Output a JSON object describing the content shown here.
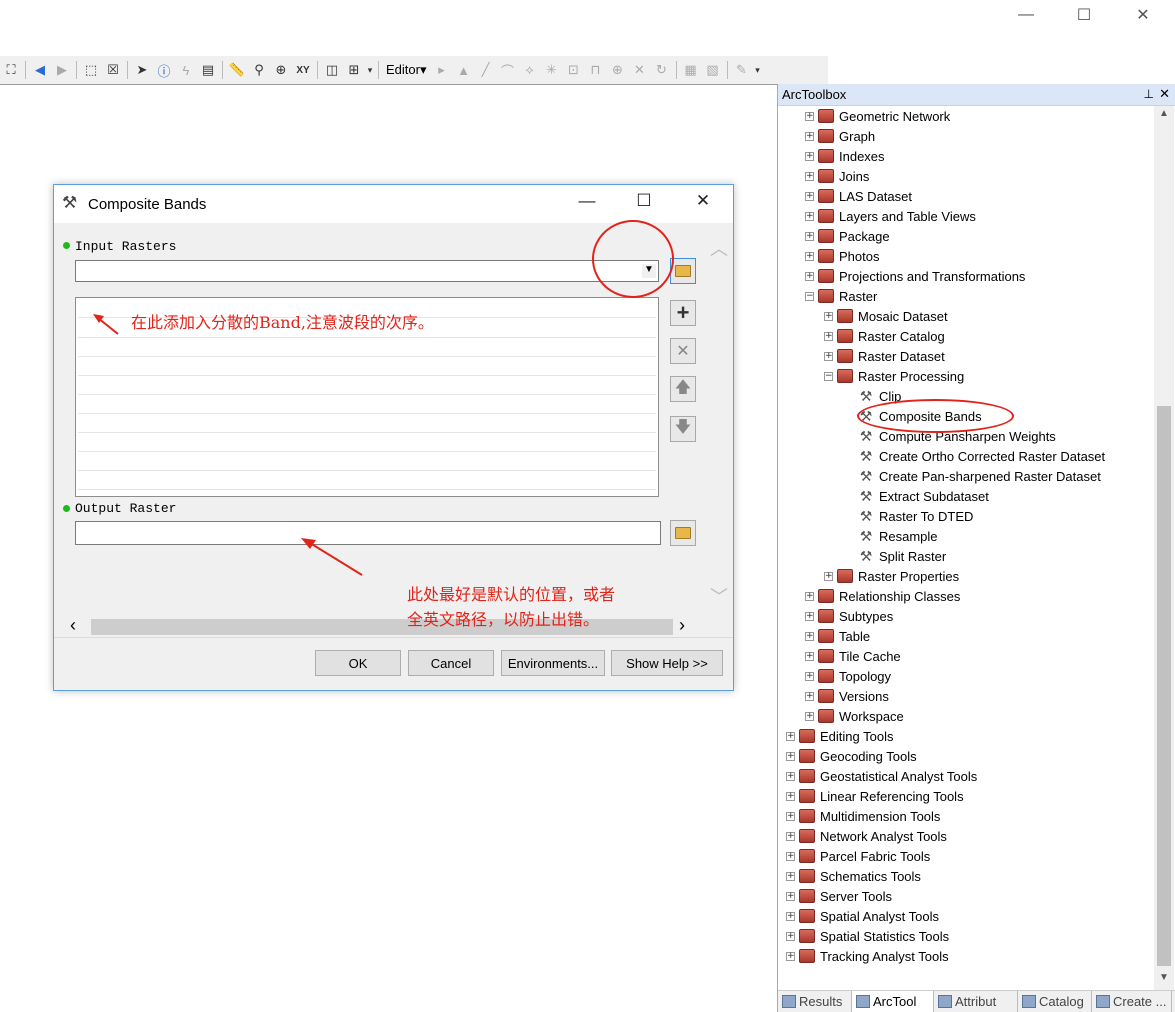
{
  "window": {
    "minimize_glyph": "—",
    "maximize_glyph": "☐",
    "close_glyph": "✕"
  },
  "toolbar": {
    "editor_label": "Editor▾"
  },
  "arctoolbox": {
    "title": "ArcToolbox",
    "pin_glyph": "ᵖ",
    "close_glyph": "✕",
    "items": [
      {
        "label": "Geometric Network",
        "level": 1,
        "expander": "+",
        "icon": "toolbox-icon"
      },
      {
        "label": "Graph",
        "level": 1,
        "expander": "+",
        "icon": "toolbox-icon"
      },
      {
        "label": "Indexes",
        "level": 1,
        "expander": "+",
        "icon": "toolbox-icon"
      },
      {
        "label": "Joins",
        "level": 1,
        "expander": "+",
        "icon": "toolbox-icon"
      },
      {
        "label": "LAS Dataset",
        "level": 1,
        "expander": "+",
        "icon": "toolbox-icon"
      },
      {
        "label": "Layers and Table Views",
        "level": 1,
        "expander": "+",
        "icon": "toolbox-icon"
      },
      {
        "label": "Package",
        "level": 1,
        "expander": "+",
        "icon": "toolbox-icon"
      },
      {
        "label": "Photos",
        "level": 1,
        "expander": "+",
        "icon": "toolbox-icon"
      },
      {
        "label": "Projections and Transformations",
        "level": 1,
        "expander": "+",
        "icon": "toolbox-icon"
      },
      {
        "label": "Raster",
        "level": 1,
        "expander": "−",
        "icon": "toolbox-icon"
      },
      {
        "label": "Mosaic Dataset",
        "level": 2,
        "expander": "+",
        "icon": "toolbox-icon"
      },
      {
        "label": "Raster Catalog",
        "level": 2,
        "expander": "+",
        "icon": "toolbox-icon"
      },
      {
        "label": "Raster Dataset",
        "level": 2,
        "expander": "+",
        "icon": "toolbox-icon"
      },
      {
        "label": "Raster Processing",
        "level": 2,
        "expander": "−",
        "icon": "toolbox-icon"
      },
      {
        "label": "Clip",
        "level": 3,
        "expander": "",
        "icon": "hammer-icon"
      },
      {
        "label": "Composite Bands",
        "level": 3,
        "expander": "",
        "icon": "hammer-icon"
      },
      {
        "label": "Compute Pansharpen Weights",
        "level": 3,
        "expander": "",
        "icon": "hammer-icon"
      },
      {
        "label": "Create Ortho Corrected Raster Dataset",
        "level": 3,
        "expander": "",
        "icon": "hammer-icon"
      },
      {
        "label": "Create Pan-sharpened Raster Dataset",
        "level": 3,
        "expander": "",
        "icon": "hammer-icon"
      },
      {
        "label": "Extract Subdataset",
        "level": 3,
        "expander": "",
        "icon": "hammer-icon"
      },
      {
        "label": "Raster To DTED",
        "level": 3,
        "expander": "",
        "icon": "hammer-icon"
      },
      {
        "label": "Resample",
        "level": 3,
        "expander": "",
        "icon": "hammer-icon"
      },
      {
        "label": "Split Raster",
        "level": 3,
        "expander": "",
        "icon": "hammer-icon"
      },
      {
        "label": "Raster Properties",
        "level": 2,
        "expander": "+",
        "icon": "toolbox-icon"
      },
      {
        "label": "Relationship Classes",
        "level": 1,
        "expander": "+",
        "icon": "toolbox-icon"
      },
      {
        "label": "Subtypes",
        "level": 1,
        "expander": "+",
        "icon": "toolbox-icon"
      },
      {
        "label": "Table",
        "level": 1,
        "expander": "+",
        "icon": "toolbox-icon"
      },
      {
        "label": "Tile Cache",
        "level": 1,
        "expander": "+",
        "icon": "toolbox-icon"
      },
      {
        "label": "Topology",
        "level": 1,
        "expander": "+",
        "icon": "toolbox-icon"
      },
      {
        "label": "Versions",
        "level": 1,
        "expander": "+",
        "icon": "toolbox-icon"
      },
      {
        "label": "Workspace",
        "level": 1,
        "expander": "+",
        "icon": "toolbox-icon"
      },
      {
        "label": "Editing Tools",
        "level": 0,
        "expander": "+",
        "icon": "toolbox-icon"
      },
      {
        "label": "Geocoding Tools",
        "level": 0,
        "expander": "+",
        "icon": "toolbox-icon"
      },
      {
        "label": "Geostatistical Analyst Tools",
        "level": 0,
        "expander": "+",
        "icon": "toolbox-icon"
      },
      {
        "label": "Linear Referencing Tools",
        "level": 0,
        "expander": "+",
        "icon": "toolbox-icon"
      },
      {
        "label": "Multidimension Tools",
        "level": 0,
        "expander": "+",
        "icon": "toolbox-icon"
      },
      {
        "label": "Network Analyst Tools",
        "level": 0,
        "expander": "+",
        "icon": "toolbox-icon"
      },
      {
        "label": "Parcel Fabric Tools",
        "level": 0,
        "expander": "+",
        "icon": "toolbox-icon"
      },
      {
        "label": "Schematics Tools",
        "level": 0,
        "expander": "+",
        "icon": "toolbox-icon"
      },
      {
        "label": "Server Tools",
        "level": 0,
        "expander": "+",
        "icon": "toolbox-icon"
      },
      {
        "label": "Spatial Analyst Tools",
        "level": 0,
        "expander": "+",
        "icon": "toolbox-icon"
      },
      {
        "label": "Spatial Statistics Tools",
        "level": 0,
        "expander": "+",
        "icon": "toolbox-icon"
      },
      {
        "label": "Tracking Analyst Tools",
        "level": 0,
        "expander": "+",
        "icon": "toolbox-icon"
      }
    ],
    "tabs": [
      {
        "label": "Results",
        "active": false
      },
      {
        "label": "ArcTool",
        "active": true
      },
      {
        "label": "Attribut",
        "active": false
      },
      {
        "label": "Catalog",
        "active": false
      },
      {
        "label": "Create ...",
        "active": false
      }
    ]
  },
  "dialog": {
    "title": "Composite Bands",
    "input_label": "Input Rasters",
    "input_value": "",
    "output_label": "Output Raster",
    "output_value": "",
    "buttons": {
      "ok": "OK",
      "cancel": "Cancel",
      "environments": "Environments...",
      "show_help": "Show Help >>"
    }
  },
  "annotations": {
    "note_list": "在此添加入分散的Band,注意波段的次序。",
    "note_output_line1": "此处最好是默认的位置，或者",
    "note_output_line2": "全英文路径，以防止出错。"
  },
  "colors": {
    "annotation": "#e2231a",
    "status_dot": "#1db91d",
    "panel_title_bg": "#dbe7f6"
  }
}
